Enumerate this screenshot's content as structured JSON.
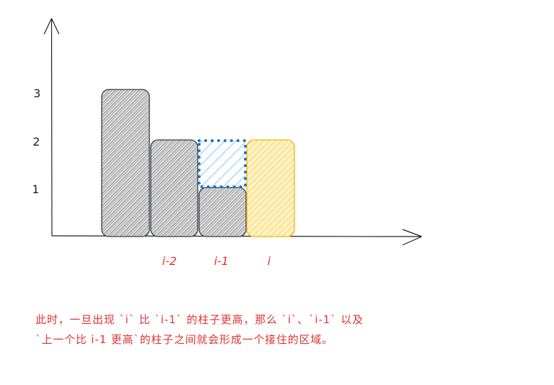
{
  "y_ticks": [
    "1",
    "2",
    "3"
  ],
  "x_labels": [
    "i-2",
    "i-1",
    "i"
  ],
  "caption": {
    "line1": "此时，一旦出现 `i` 比 `i-1` 的柱子更高，那么 `i`、`i-1` 以及",
    "line2": "`上一个比 i-1 更高`的柱子之间就会形成一个接住的区域。"
  },
  "colors": {
    "bar": "#868e96",
    "highlight_bar": "#fab005",
    "water_outline": "#1971c2",
    "water_fill": "#a5d8ff",
    "text": "#e03131",
    "axis": "#1e1e1e"
  }
}
